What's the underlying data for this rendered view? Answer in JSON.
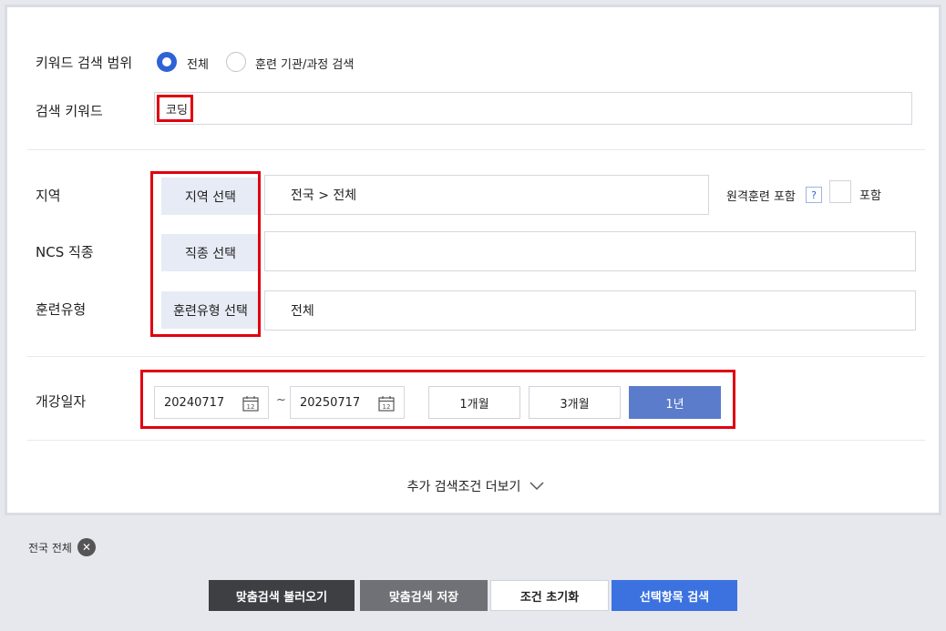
{
  "keyword_scope": {
    "label": "키워드 검색 범위",
    "options": [
      {
        "label": "전체",
        "selected": true
      },
      {
        "label": "훈련 기관/과정 검색",
        "selected": false
      }
    ]
  },
  "keyword": {
    "label": "검색 키워드",
    "value": "코딩"
  },
  "region": {
    "label": "지역",
    "button": "지역 선택",
    "value": "전국 > 전체"
  },
  "remote": {
    "label": "원격훈련 포함",
    "help": "?",
    "checkbox_label": "포함"
  },
  "ncs": {
    "label": "NCS 직종",
    "button": "직종 선택",
    "value": ""
  },
  "training_type": {
    "label": "훈련유형",
    "button": "훈련유형 선택",
    "value": "전체"
  },
  "open_date": {
    "label": "개강일자",
    "start": "20240717",
    "end": "20250717",
    "separator": "~",
    "calendar_day": "12",
    "periods": [
      {
        "label": "1개월",
        "selected": false
      },
      {
        "label": "3개월",
        "selected": false
      },
      {
        "label": "1년",
        "selected": true
      }
    ]
  },
  "more_conditions": "추가 검색조건 더보기",
  "chips": [
    {
      "label": "전국 전체",
      "close": "✕"
    }
  ],
  "actions": {
    "load": "맞춤검색 불러오기",
    "save": "맞춤검색 저장",
    "reset": "조건 초기화",
    "search": "선택항목 검색"
  },
  "colors": {
    "accent": "#2f62d6",
    "selected_period": "#5b7ccb",
    "search_button": "#3b72e0",
    "highlight": "#e0000f"
  }
}
